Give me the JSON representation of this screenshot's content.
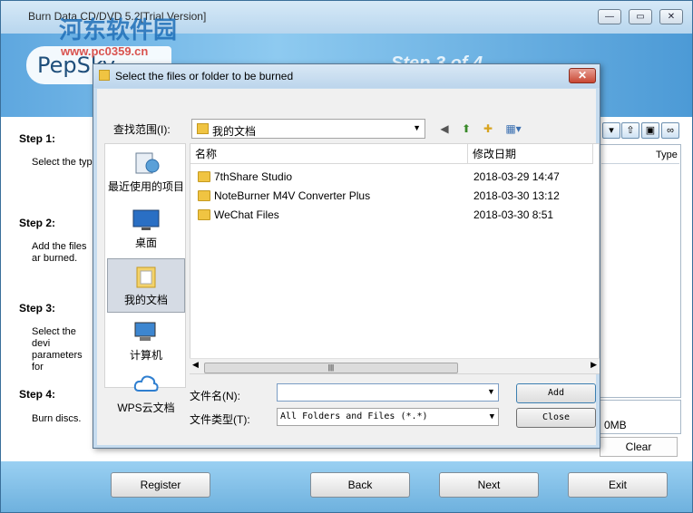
{
  "app": {
    "title": "Burn Data CD/DVD 5.2[Trial Version]",
    "watermark": "河东软件园",
    "watermark_url": "www.pc0359.cn",
    "logo": "PepSky",
    "step_title": "Step 3 of 4"
  },
  "steps": [
    {
      "label": "Step 1:",
      "desc": "Select the type"
    },
    {
      "label": "Step 2:",
      "desc": "Add the files ar burned."
    },
    {
      "label": "Step 3:",
      "desc": "Select the devi parameters for"
    },
    {
      "label": "Step 4:",
      "desc": "Burn discs."
    }
  ],
  "panel": {
    "type_col": "Type",
    "size_text": "0MB",
    "clear_label": "Clear"
  },
  "nav": {
    "register": "Register",
    "back": "Back",
    "next": "Next",
    "exit": "Exit"
  },
  "dialog": {
    "title": "Select the files or folder to be burned",
    "look_in_label": "查找范围(I):",
    "look_in_value": "我的文档",
    "places": [
      {
        "label": "最近使用的项目",
        "icon": "recent-items-icon"
      },
      {
        "label": "桌面",
        "icon": "desktop-icon"
      },
      {
        "label": "我的文档",
        "icon": "documents-icon"
      },
      {
        "label": "计算机",
        "icon": "computer-icon"
      },
      {
        "label": "WPS云文档",
        "icon": "cloud-icon"
      }
    ],
    "columns": {
      "name": "名称",
      "modified": "修改日期"
    },
    "files": [
      {
        "name": "7thShare Studio",
        "date": "2018-03-29 14:47"
      },
      {
        "name": "NoteBurner M4V Converter Plus",
        "date": "2018-03-30 13:12"
      },
      {
        "name": "WeChat Files",
        "date": "2018-03-30 8:51"
      }
    ],
    "filename_label": "文件名(N):",
    "filename_value": "",
    "filetype_label": "文件类型(T):",
    "filetype_value": "All Folders and Files (*.*)",
    "add_label": "Add",
    "close_label": "Close"
  }
}
